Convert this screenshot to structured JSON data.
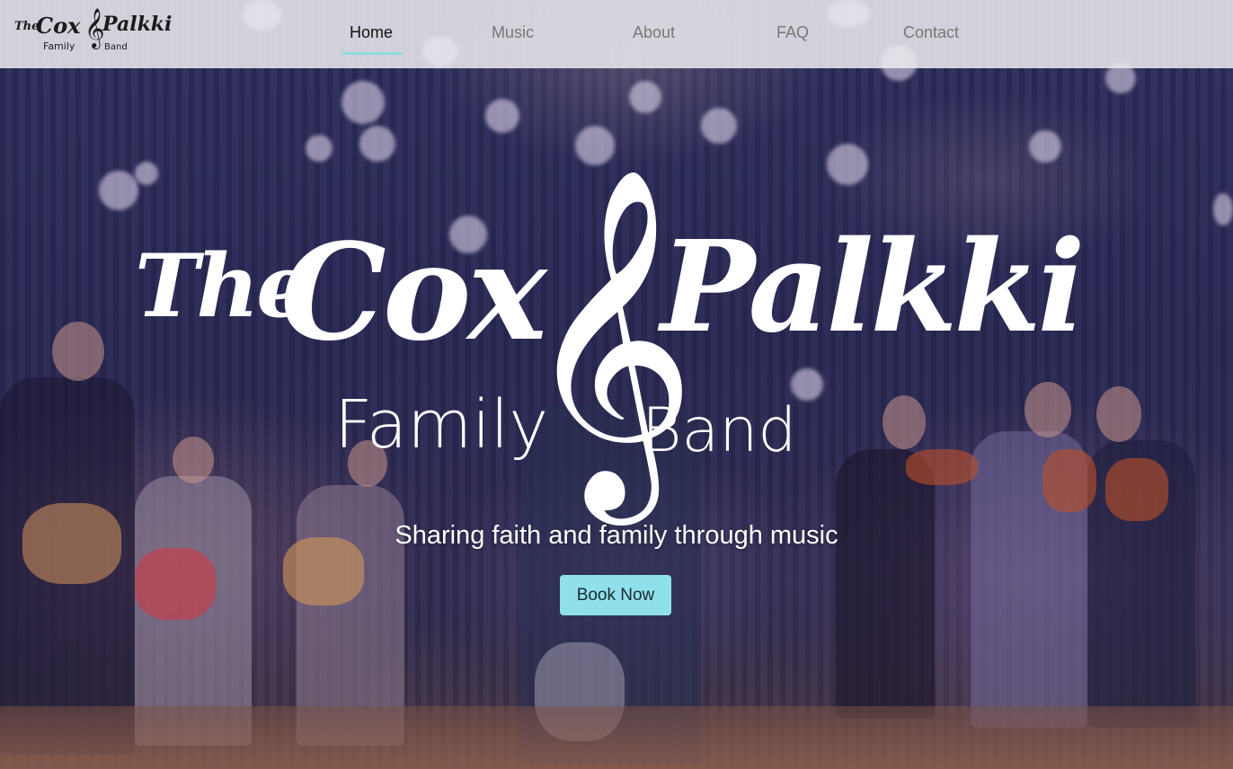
{
  "logo": {
    "the": "The",
    "cox": "Cox",
    "clef": "𝄞",
    "palkki": "Palkki",
    "family": "Family",
    "band": "Band"
  },
  "nav": {
    "items": [
      {
        "label": "Home",
        "active": true
      },
      {
        "label": "Music",
        "active": false
      },
      {
        "label": "About",
        "active": false
      },
      {
        "label": "FAQ",
        "active": false
      },
      {
        "label": "Contact",
        "active": false
      }
    ]
  },
  "hero": {
    "logo": {
      "the": "The",
      "cox": "Cox",
      "clef": "𝄞",
      "palkki": "Palkki",
      "family": "Family",
      "band": "Band"
    },
    "tagline": "Sharing faith and family through music",
    "cta_label": "Book Now"
  },
  "colors": {
    "accent": "#8fe0ea",
    "nav_underline": "#8fd9e3",
    "overlay": "#2b2a55"
  }
}
